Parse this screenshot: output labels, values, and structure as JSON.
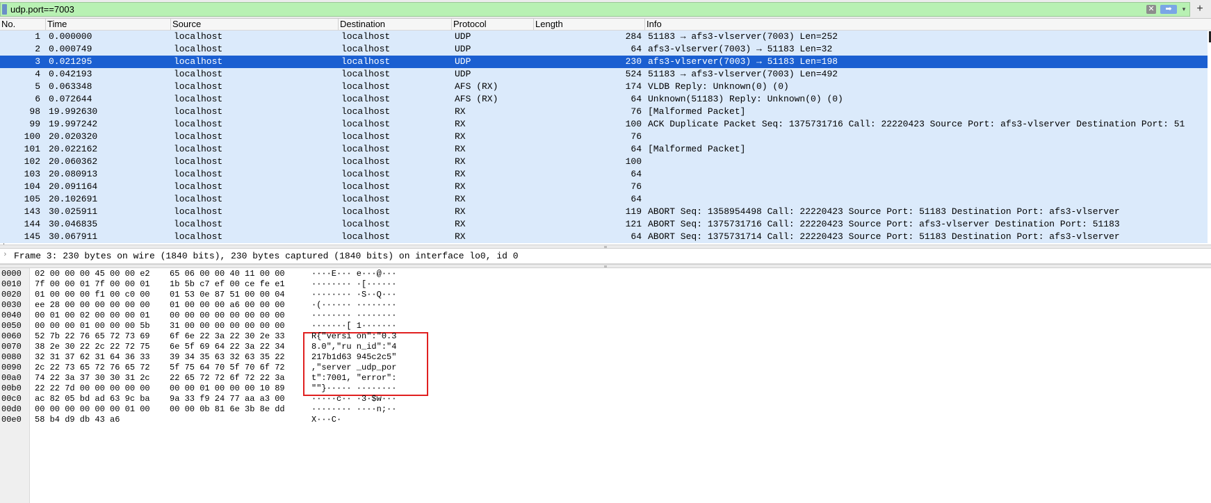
{
  "filter": {
    "value": "udp.port==7003",
    "clear_glyph": "✕",
    "apply_glyph": "➡",
    "dropdown_glyph": "▾",
    "add_glyph": "+"
  },
  "columns": [
    "No.",
    "Time",
    "Source",
    "Destination",
    "Protocol",
    "Length",
    "Info"
  ],
  "packets": [
    {
      "no": "1",
      "time": "0.000000",
      "src": "localhost",
      "dst": "localhost",
      "proto": "UDP",
      "len": "284",
      "info": "51183 → afs3-vlserver(7003) Len=252"
    },
    {
      "no": "2",
      "time": "0.000749",
      "src": "localhost",
      "dst": "localhost",
      "proto": "UDP",
      "len": "64",
      "info": "afs3-vlserver(7003) → 51183 Len=32"
    },
    {
      "no": "3",
      "time": "0.021295",
      "src": "localhost",
      "dst": "localhost",
      "proto": "UDP",
      "len": "230",
      "info": "afs3-vlserver(7003) → 51183 Len=198"
    },
    {
      "no": "4",
      "time": "0.042193",
      "src": "localhost",
      "dst": "localhost",
      "proto": "UDP",
      "len": "524",
      "info": "51183 → afs3-vlserver(7003) Len=492"
    },
    {
      "no": "5",
      "time": "0.063348",
      "src": "localhost",
      "dst": "localhost",
      "proto": "AFS (RX)",
      "len": "174",
      "info": "VLDB Reply: Unknown(0) (0)"
    },
    {
      "no": "6",
      "time": "0.072644",
      "src": "localhost",
      "dst": "localhost",
      "proto": "AFS (RX)",
      "len": "64",
      "info": "Unknown(51183) Reply: Unknown(0) (0)"
    },
    {
      "no": "98",
      "time": "19.992630",
      "src": "localhost",
      "dst": "localhost",
      "proto": "RX",
      "len": "76",
      "info": "[Malformed Packet]"
    },
    {
      "no": "99",
      "time": "19.997242",
      "src": "localhost",
      "dst": "localhost",
      "proto": "RX",
      "len": "100",
      "info": "ACK Duplicate Packet  Seq: 1375731716  Call: 22220423  Source Port: afs3-vlserver  Destination Port: 51"
    },
    {
      "no": "100",
      "time": "20.020320",
      "src": "localhost",
      "dst": "localhost",
      "proto": "RX",
      "len": "76",
      "info": ""
    },
    {
      "no": "101",
      "time": "20.022162",
      "src": "localhost",
      "dst": "localhost",
      "proto": "RX",
      "len": "64",
      "info": "[Malformed Packet]"
    },
    {
      "no": "102",
      "time": "20.060362",
      "src": "localhost",
      "dst": "localhost",
      "proto": "RX",
      "len": "100",
      "info": ""
    },
    {
      "no": "103",
      "time": "20.080913",
      "src": "localhost",
      "dst": "localhost",
      "proto": "RX",
      "len": "64",
      "info": ""
    },
    {
      "no": "104",
      "time": "20.091164",
      "src": "localhost",
      "dst": "localhost",
      "proto": "RX",
      "len": "76",
      "info": ""
    },
    {
      "no": "105",
      "time": "20.102691",
      "src": "localhost",
      "dst": "localhost",
      "proto": "RX",
      "len": "64",
      "info": ""
    },
    {
      "no": "143",
      "time": "30.025911",
      "src": "localhost",
      "dst": "localhost",
      "proto": "RX",
      "len": "119",
      "info": "ABORT  Seq: 1358954498  Call: 22220423  Source Port: 51183  Destination Port: afs3-vlserver"
    },
    {
      "no": "144",
      "time": "30.046835",
      "src": "localhost",
      "dst": "localhost",
      "proto": "RX",
      "len": "121",
      "info": "ABORT  Seq: 1375731716  Call: 22220423  Source Port: afs3-vlserver  Destination Port: 51183"
    },
    {
      "no": "145",
      "time": "30.067911",
      "src": "localhost",
      "dst": "localhost",
      "proto": "RX",
      "len": "64",
      "info": "ABORT  Seq: 1375731714  Call: 22220423  Source Port: 51183  Destination Port: afs3-vlserver"
    }
  ],
  "selected_packet": "3",
  "details": {
    "arrow_glyph": "›",
    "frame_line": "Frame 3: 230 bytes on wire (1840 bits), 230 bytes captured (1840 bits) on interface lo0, id 0"
  },
  "bytes": [
    {
      "offset": "0000",
      "hex1": "02 00 00 00 45 00 00 e2",
      "hex2": "65 06 00 00 40 11 00 00",
      "ascii": "····E··· e···@···"
    },
    {
      "offset": "0010",
      "hex1": "7f 00 00 01 7f 00 00 01",
      "hex2": "1b 5b c7 ef 00 ce fe e1",
      "ascii": "········ ·[······"
    },
    {
      "offset": "0020",
      "hex1": "01 00 00 00 f1 00 c0 00",
      "hex2": "01 53 0e 87 51 00 00 04",
      "ascii": "········ ·S··Q···"
    },
    {
      "offset": "0030",
      "hex1": "ee 28 00 00 00 00 00 00",
      "hex2": "01 00 00 00 a6 00 00 00",
      "ascii": "·(······ ········"
    },
    {
      "offset": "0040",
      "hex1": "00 01 00 02 00 00 00 01",
      "hex2": "00 00 00 00 00 00 00 00",
      "ascii": "········ ········"
    },
    {
      "offset": "0050",
      "hex1": "00 00 00 01 00 00 00 5b",
      "hex2": "31 00 00 00 00 00 00 00",
      "ascii": "·······[ 1·······"
    },
    {
      "offset": "0060",
      "hex1": "52 7b 22 76 65 72 73 69",
      "hex2": "6f 6e 22 3a 22 30 2e 33",
      "ascii": "R{\"versi on\":\"0.3"
    },
    {
      "offset": "0070",
      "hex1": "38 2e 30 22 2c 22 72 75",
      "hex2": "6e 5f 69 64 22 3a 22 34",
      "ascii": "8.0\",\"ru n_id\":\"4"
    },
    {
      "offset": "0080",
      "hex1": "32 31 37 62 31 64 36 33",
      "hex2": "39 34 35 63 32 63 35 22",
      "ascii": "217b1d63 945c2c5\""
    },
    {
      "offset": "0090",
      "hex1": "2c 22 73 65 72 76 65 72",
      "hex2": "5f 75 64 70 5f 70 6f 72",
      "ascii": ",\"server _udp_por"
    },
    {
      "offset": "00a0",
      "hex1": "74 22 3a 37 30 30 31 2c",
      "hex2": "22 65 72 72 6f 72 22 3a",
      "ascii": "t\":7001, \"error\":"
    },
    {
      "offset": "00b0",
      "hex1": "22 22 7d 00 00 00 00 00",
      "hex2": "00 00 01 00 00 00 10 89",
      "ascii": "\"\"}····· ········"
    },
    {
      "offset": "00c0",
      "hex1": "ac 82 05 bd ad 63 9c ba",
      "hex2": "9a 33 f9 24 77 aa a3 00",
      "ascii": "·····c·· ·3·$w···"
    },
    {
      "offset": "00d0",
      "hex1": "00 00 00 00 00 00 01 00",
      "hex2": "00 00 0b 81 6e 3b 8e dd",
      "ascii": "········ ····n;··"
    },
    {
      "offset": "00e0",
      "hex1": "58 b4 d9 db 43 a6",
      "hex2": "",
      "ascii": "X···C·"
    }
  ],
  "colors": {
    "filter_bg": "#b8f1b3",
    "row_bg": "#dbeafb",
    "selected_bg": "#1b5fd1",
    "highlight_border": "#e02020"
  }
}
